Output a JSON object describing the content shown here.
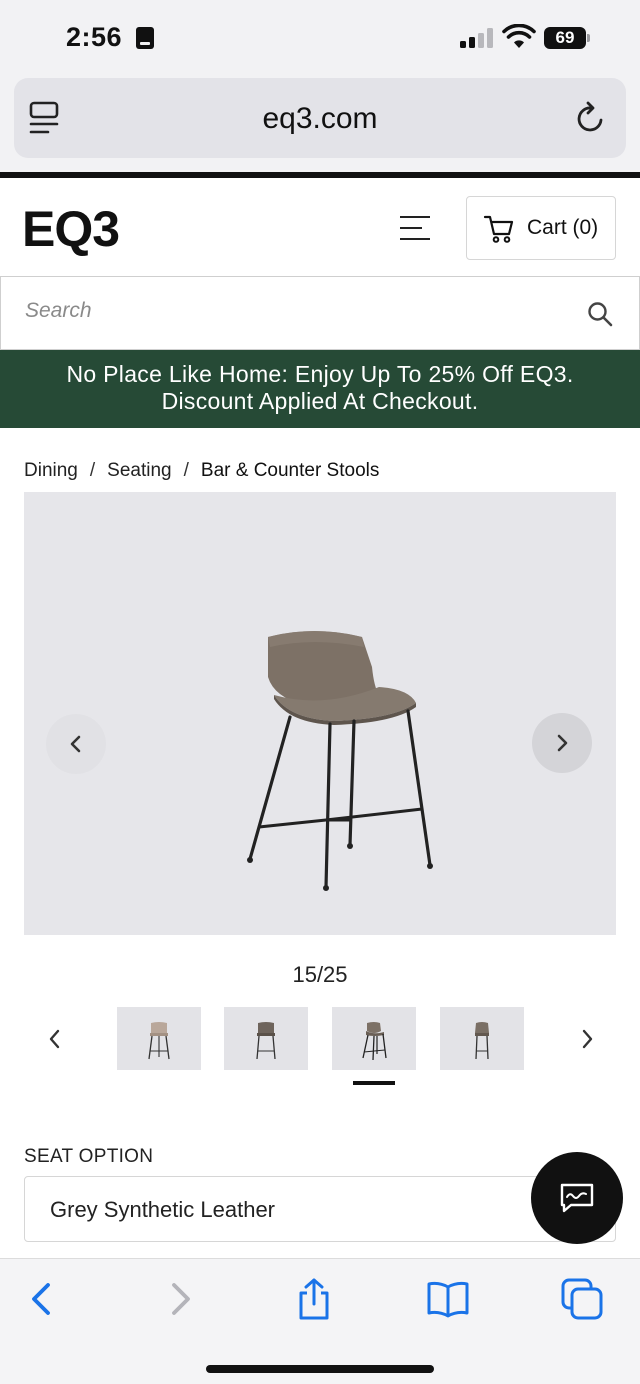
{
  "status_bar": {
    "time": "2:56",
    "battery": "69"
  },
  "browser": {
    "url": "eq3.com"
  },
  "header": {
    "logo": "EQ3",
    "cart_label": "Cart (0)"
  },
  "search": {
    "placeholder": "Search"
  },
  "promo": {
    "line1": "No Place Like Home: Enjoy Up To 25% Off EQ3.",
    "line2": "Discount Applied At Checkout.",
    "background": "#264a36"
  },
  "breadcrumb": {
    "items": [
      "Dining",
      "Seating",
      "Bar & Counter Stools"
    ],
    "separator": "/"
  },
  "gallery": {
    "counter": "15/25"
  },
  "product": {
    "seat_option_label": "SEAT OPTION",
    "seat_option_value": "Grey Synthetic Leather"
  },
  "icons": {
    "status": [
      "book-icon",
      "signal-icon",
      "wifi-icon",
      "battery-icon"
    ],
    "browser": [
      "page-menu-icon",
      "reload-icon"
    ],
    "header": [
      "menu-icon",
      "cart-icon"
    ],
    "toolbar": [
      "back-icon",
      "forward-icon",
      "share-icon",
      "bookmarks-icon",
      "tabs-icon"
    ]
  },
  "colors": {
    "accent_blue": "#1a73e8",
    "promo_green": "#264a36"
  }
}
